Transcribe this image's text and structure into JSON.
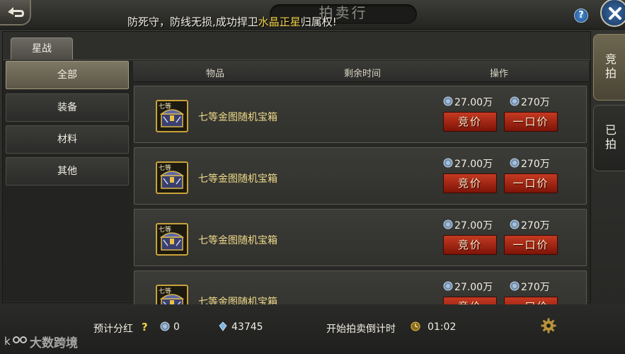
{
  "window": {
    "title": "拍卖行",
    "announcement_pre": "防死守，防线无损,成功捍卫",
    "announcement_hl": "水晶正星",
    "announcement_post": "归属权!"
  },
  "right_tabs": [
    {
      "label": "竞拍",
      "active": true
    },
    {
      "label": "已拍",
      "active": false
    }
  ],
  "category_tab": "星战",
  "sidebar": {
    "items": [
      {
        "label": "全部",
        "active": true
      },
      {
        "label": "装备",
        "active": false
      },
      {
        "label": "材料",
        "active": false
      },
      {
        "label": "其他",
        "active": false
      }
    ]
  },
  "list": {
    "headers": {
      "item": "物品",
      "time": "剩余时间",
      "action": "操作"
    },
    "rows": [
      {
        "tier": "七等",
        "name": "七等金图随机宝箱",
        "bid_price": "27.00万",
        "buyout_price": "270万",
        "bid_label": "竞价",
        "buy_label": "一口价"
      },
      {
        "tier": "七等",
        "name": "七等金图随机宝箱",
        "bid_price": "27.00万",
        "buyout_price": "270万",
        "bid_label": "竞价",
        "buy_label": "一口价"
      },
      {
        "tier": "七等",
        "name": "七等金图随机宝箱",
        "bid_price": "27.00万",
        "buyout_price": "270万",
        "bid_label": "竞价",
        "buy_label": "一口价"
      },
      {
        "tier": "七等",
        "name": "七等金图随机宝箱",
        "bid_price": "27.00万",
        "buyout_price": "270万",
        "bid_label": "竞价",
        "buy_label": "一口价"
      }
    ]
  },
  "footer": {
    "dividend_label": "预计分红",
    "dividend_help": "?",
    "dividend_value": "0",
    "diamonds": "43745",
    "countdown_label": "开始拍卖倒计时",
    "countdown_value": "01:02"
  },
  "watermark": "大数跨境",
  "colors": {
    "accent_gold": "#f2d34a",
    "button_red": "#c53a22"
  }
}
